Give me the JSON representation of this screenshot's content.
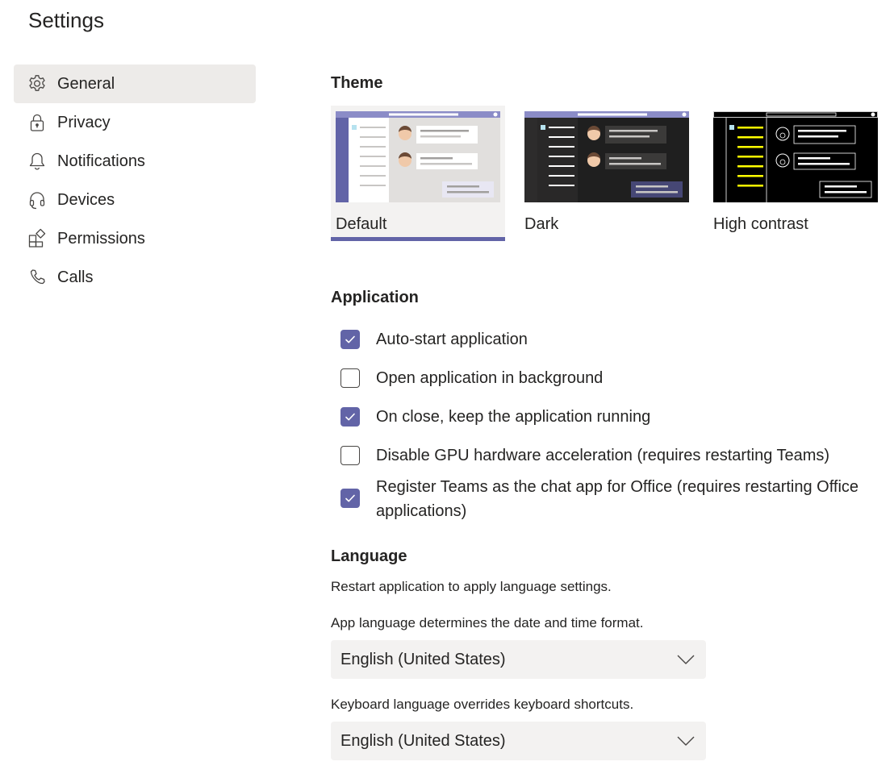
{
  "page_title": "Settings",
  "nav": [
    {
      "label": "General",
      "icon": "gear-icon",
      "active": true
    },
    {
      "label": "Privacy",
      "icon": "lock-icon",
      "active": false
    },
    {
      "label": "Notifications",
      "icon": "bell-icon",
      "active": false
    },
    {
      "label": "Devices",
      "icon": "headset-icon",
      "active": false
    },
    {
      "label": "Permissions",
      "icon": "apps-icon",
      "active": false
    },
    {
      "label": "Calls",
      "icon": "phone-icon",
      "active": false
    }
  ],
  "theme": {
    "title": "Theme",
    "options": [
      {
        "label": "Default",
        "selected": true
      },
      {
        "label": "Dark",
        "selected": false
      },
      {
        "label": "High contrast",
        "selected": false
      }
    ]
  },
  "application": {
    "title": "Application",
    "options": [
      {
        "label": "Auto-start application",
        "checked": true
      },
      {
        "label": "Open application in background",
        "checked": false
      },
      {
        "label": "On close, keep the application running",
        "checked": true
      },
      {
        "label": "Disable GPU hardware acceleration (requires restarting Teams)",
        "checked": false
      },
      {
        "label": "Register Teams as the chat app for Office (requires restarting Office applications)",
        "checked": true
      }
    ]
  },
  "language": {
    "title": "Language",
    "restart_note": "Restart application to apply language settings.",
    "app_language_hint": "App language determines the date and time format.",
    "app_language_value": "English (United States)",
    "keyboard_language_hint": "Keyboard language overrides keyboard shortcuts.",
    "keyboard_language_value": "English (United States)"
  },
  "colors": {
    "accent": "#6264a7",
    "nav_active_bg": "#edebe9",
    "select_bg": "#f3f2f1",
    "text": "#252423"
  }
}
